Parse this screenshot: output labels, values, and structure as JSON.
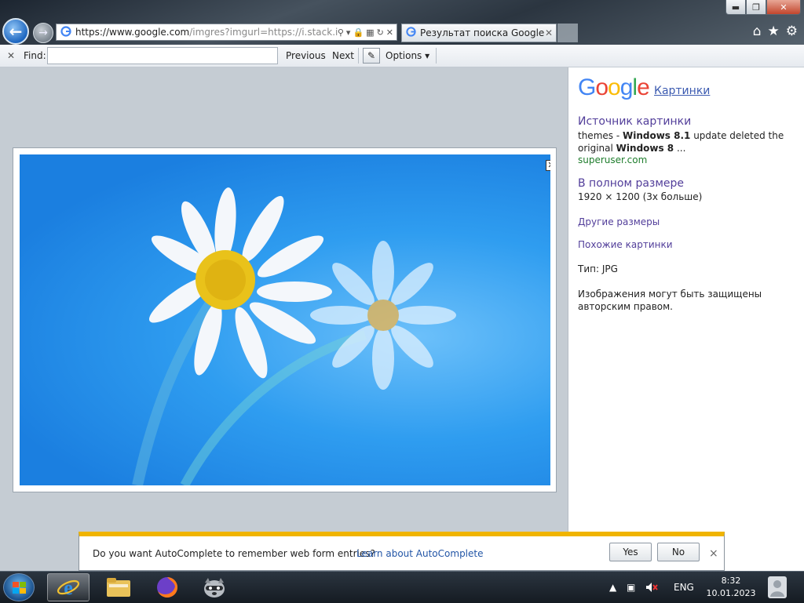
{
  "browser": {
    "address": {
      "url_prefix": "https://",
      "url_host": "www.google.com",
      "url_rest": "/imgres?imgurl=https://i.stack.in"
    },
    "tab_title": "Результат поиска Google д...",
    "window_buttons": {
      "minimize": "▬",
      "maximize": "❐",
      "close": "✕"
    },
    "right_icons": {
      "home": "⌂",
      "favorites": "★",
      "settings": "⚙"
    }
  },
  "findbar": {
    "label": "Find:",
    "value": "",
    "previous": "Previous",
    "next": "Next",
    "options": "Options"
  },
  "panel": {
    "logo_letters": [
      "G",
      "o",
      "o",
      "g",
      "l",
      "e"
    ],
    "logo_colors": [
      "#4285F4",
      "#EA4335",
      "#FBBC05",
      "#4285F4",
      "#34A853",
      "#EA4335"
    ],
    "images_link": "Картинки",
    "source_title": "Источник картинки",
    "source_desc_1": "themes - ",
    "source_desc_bold1": "Windows 8.1",
    "source_desc_2": " update deleted the original ",
    "source_desc_bold2": "Windows 8",
    "source_desc_3": " ...",
    "source_site": "superuser.com",
    "full_title": "В полном размере",
    "full_size": "1920 × 1200 (3x больше)",
    "other_sizes": "Другие размеры",
    "similar": "Похожие картинки",
    "type": "Тип:  JPG",
    "copyright": "Изображения могут быть защищены авторским правом."
  },
  "viewer": {
    "close_label": "✕"
  },
  "autocomplete": {
    "message": "Do you want AutoComplete to remember web form entries?",
    "learn": "Learn about AutoComplete",
    "yes": "Yes",
    "no": "No",
    "close": "×"
  },
  "taskbar": {
    "language": "ENG",
    "time": "8:32",
    "date": "10.01.2023"
  },
  "colors": {
    "accent_bar": "#f0b400",
    "link": "#523e9a",
    "site_green": "#1e7d2c"
  }
}
